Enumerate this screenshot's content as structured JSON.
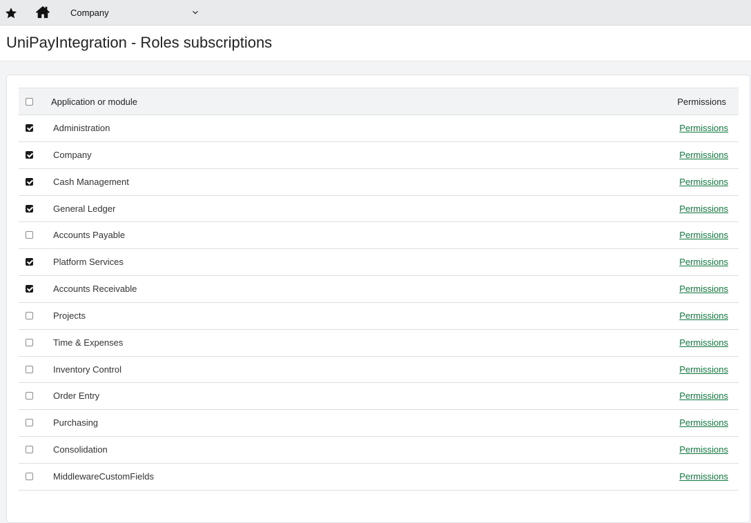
{
  "topbar": {
    "favorites_icon": "star-icon",
    "home_icon": "home-icon",
    "company_select": {
      "value": "Company",
      "icon": "chevron-down-icon"
    }
  },
  "page": {
    "title": "UniPayIntegration - Roles subscriptions"
  },
  "grid": {
    "headers": {
      "select_all_checked": false,
      "application": "Application or module",
      "permissions": "Permissions"
    },
    "rows": [
      {
        "name": "Administration",
        "checked": true,
        "link": "Permissions"
      },
      {
        "name": "Company",
        "checked": true,
        "link": "Permissions"
      },
      {
        "name": "Cash Management",
        "checked": true,
        "link": "Permissions"
      },
      {
        "name": "General Ledger",
        "checked": true,
        "link": "Permissions"
      },
      {
        "name": "Accounts Payable",
        "checked": false,
        "link": "Permissions"
      },
      {
        "name": "Platform Services",
        "checked": true,
        "link": "Permissions"
      },
      {
        "name": "Accounts Receivable",
        "checked": true,
        "link": "Permissions"
      },
      {
        "name": "Projects",
        "checked": false,
        "link": "Permissions"
      },
      {
        "name": "Time & Expenses",
        "checked": false,
        "link": "Permissions"
      },
      {
        "name": "Inventory Control",
        "checked": false,
        "link": "Permissions"
      },
      {
        "name": "Order Entry",
        "checked": false,
        "link": "Permissions"
      },
      {
        "name": "Purchasing",
        "checked": false,
        "link": "Permissions"
      },
      {
        "name": "Consolidation",
        "checked": false,
        "link": "Permissions"
      },
      {
        "name": "MiddlewareCustomFields",
        "checked": false,
        "link": "Permissions"
      }
    ]
  },
  "colors": {
    "link": "#0d7a3c",
    "topbar_bg": "#e8eaeb",
    "page_bg": "#f3f4f5"
  }
}
